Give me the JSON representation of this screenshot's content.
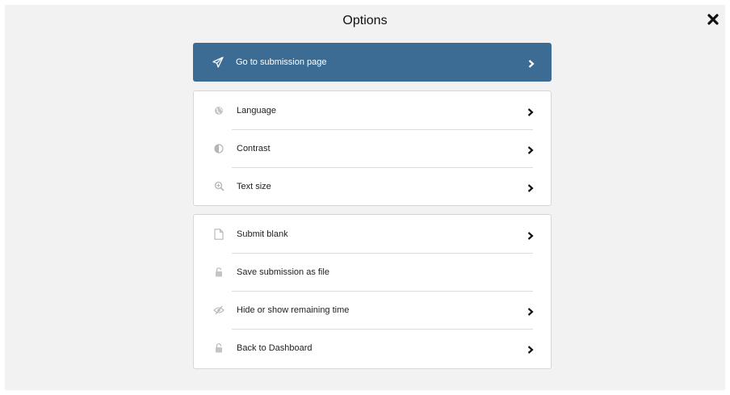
{
  "dialog": {
    "title": "Options"
  },
  "primary": {
    "label": "Go to submission page"
  },
  "group1": {
    "items": [
      {
        "label": "Language",
        "icon": "globe-icon"
      },
      {
        "label": "Contrast",
        "icon": "contrast-icon"
      },
      {
        "label": "Text size",
        "icon": "zoom-icon"
      }
    ]
  },
  "group2": {
    "items": [
      {
        "label": "Submit blank",
        "icon": "file-icon"
      },
      {
        "label": "Save submission as file",
        "icon": "lock-icon"
      },
      {
        "label": "Hide or show remaining time",
        "icon": "eye-slash-icon"
      },
      {
        "label": "Back to Dashboard",
        "icon": "lock-icon"
      }
    ]
  },
  "colors": {
    "primary": "#3c6c94",
    "panel": "#f2f2f2",
    "icon": "#b5b5b5"
  }
}
